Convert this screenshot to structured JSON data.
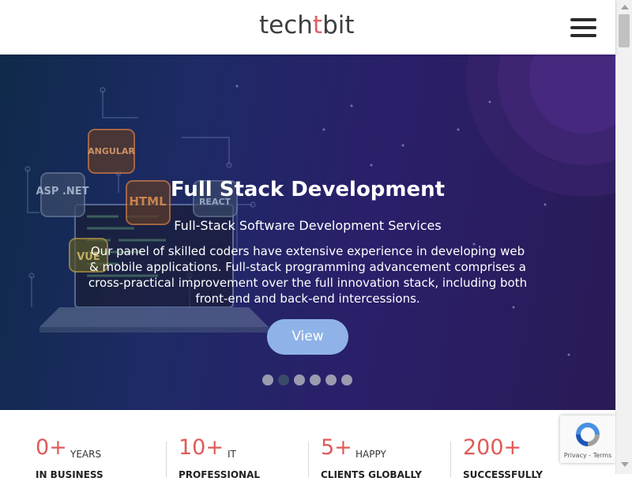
{
  "header": {
    "logo_prefix": "tech",
    "logo_mark": "t",
    "logo_suffix": "bit",
    "menu_icon": "hamburger-menu-icon"
  },
  "hero": {
    "title": "Full Stack Development",
    "subtitle": "Full-Stack Software Development Services",
    "description": "Our panel of skilled coders have extensive experience in developing web & mobile applications. Full-stack programming advancement comprises a cross-practical improvement over the full innovation stack, including both front-end and back-end intercessions.",
    "button_label": "View",
    "art_labels": [
      "ANGULAR",
      "ASP .NET",
      "HTML",
      "REACT",
      "VUE"
    ],
    "slides": 6,
    "active_slide": 2
  },
  "stats": [
    {
      "number": "0+",
      "unit": "YEARS",
      "label": "IN BUSINESS"
    },
    {
      "number": "10+",
      "unit": "IT",
      "label": "PROFESSIONAL"
    },
    {
      "number": "5+",
      "unit": "HAPPY",
      "label": "CLIENTS GLOBALLY"
    },
    {
      "number": "200+",
      "unit": "",
      "label": "SUCCESSFULLY"
    }
  ],
  "recaptcha": {
    "links": "Privacy - Terms",
    "icon": "recaptcha-icon"
  },
  "colors": {
    "accent": "#e05a5a",
    "button": "#8fb3e8",
    "hero_bg": "#1e2a66"
  }
}
